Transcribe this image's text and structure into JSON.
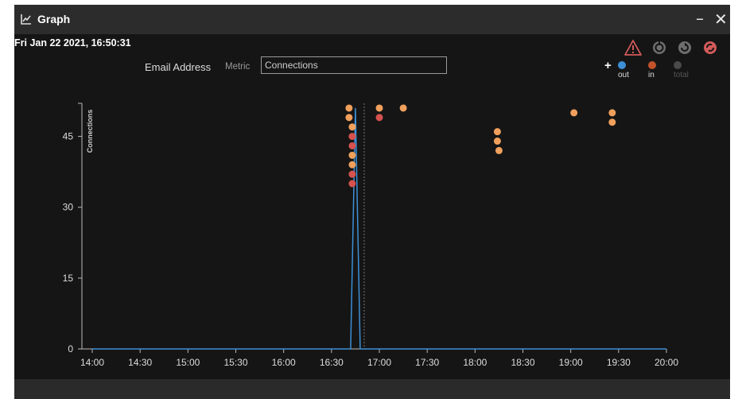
{
  "window": {
    "title": "Graph",
    "minimize_label": "–",
    "close_label": "✕",
    "title_icon": "line-chart-icon"
  },
  "header": {
    "timestamp": "Fri Jan 22 2021, 16:50:31",
    "metric_target": "Email Address",
    "metric_label": "Metric",
    "metric_value": "Connections"
  },
  "toolbar": {
    "icons": [
      "warning-icon",
      "reset-icon",
      "refresh-icon",
      "auto-refresh-icon"
    ]
  },
  "legend": {
    "add_icon": "plus-icon",
    "items": [
      {
        "label": "out",
        "color": "#3d8fd6"
      },
      {
        "label": "in",
        "color": "#c2532a"
      },
      {
        "label": "total",
        "color": "#4a4a4a"
      }
    ]
  },
  "chart_data": {
    "type": "line",
    "ylabel": "Connections",
    "xlabel": "",
    "y_ticks": [
      "0",
      "15",
      "30",
      "45"
    ],
    "ylim": [
      0,
      52
    ],
    "x_ticks": [
      "14:00",
      "14:30",
      "15:00",
      "15:30",
      "16:00",
      "16:30",
      "17:00",
      "17:30",
      "18:00",
      "18:30",
      "19:00",
      "19:30",
      "20:00"
    ],
    "xlim_minutes": [
      840,
      1200
    ],
    "current_time_minutes": 1010.5,
    "series": [
      {
        "name": "out",
        "color": "#3d8fd6",
        "points": [
          [
            840,
            0
          ],
          [
            1002,
            0
          ],
          [
            1005,
            51
          ],
          [
            1008,
            0
          ],
          [
            1200,
            0
          ]
        ]
      }
    ],
    "events": [
      {
        "x": 1001,
        "y": 51,
        "color": "#f0a05c"
      },
      {
        "x": 1001,
        "y": 49,
        "color": "#f0a05c"
      },
      {
        "x": 1003,
        "y": 47,
        "color": "#f0a05c"
      },
      {
        "x": 1003,
        "y": 45,
        "color": "#d5524f"
      },
      {
        "x": 1003,
        "y": 43,
        "color": "#d5524f"
      },
      {
        "x": 1003,
        "y": 41,
        "color": "#f0a05c"
      },
      {
        "x": 1003,
        "y": 39,
        "color": "#f0a05c"
      },
      {
        "x": 1003,
        "y": 37,
        "color": "#d5524f"
      },
      {
        "x": 1003,
        "y": 35,
        "color": "#d5524f"
      },
      {
        "x": 1020,
        "y": 51,
        "color": "#f0a05c"
      },
      {
        "x": 1020,
        "y": 49,
        "color": "#d5524f"
      },
      {
        "x": 1035,
        "y": 51,
        "color": "#f0a05c"
      },
      {
        "x": 1094,
        "y": 46,
        "color": "#f0a05c"
      },
      {
        "x": 1094,
        "y": 44,
        "color": "#f0a05c"
      },
      {
        "x": 1095,
        "y": 42,
        "color": "#f0a05c"
      },
      {
        "x": 1142,
        "y": 50,
        "color": "#f0a05c"
      },
      {
        "x": 1166,
        "y": 50,
        "color": "#f0a05c"
      },
      {
        "x": 1166,
        "y": 48,
        "color": "#f0a05c"
      }
    ]
  }
}
